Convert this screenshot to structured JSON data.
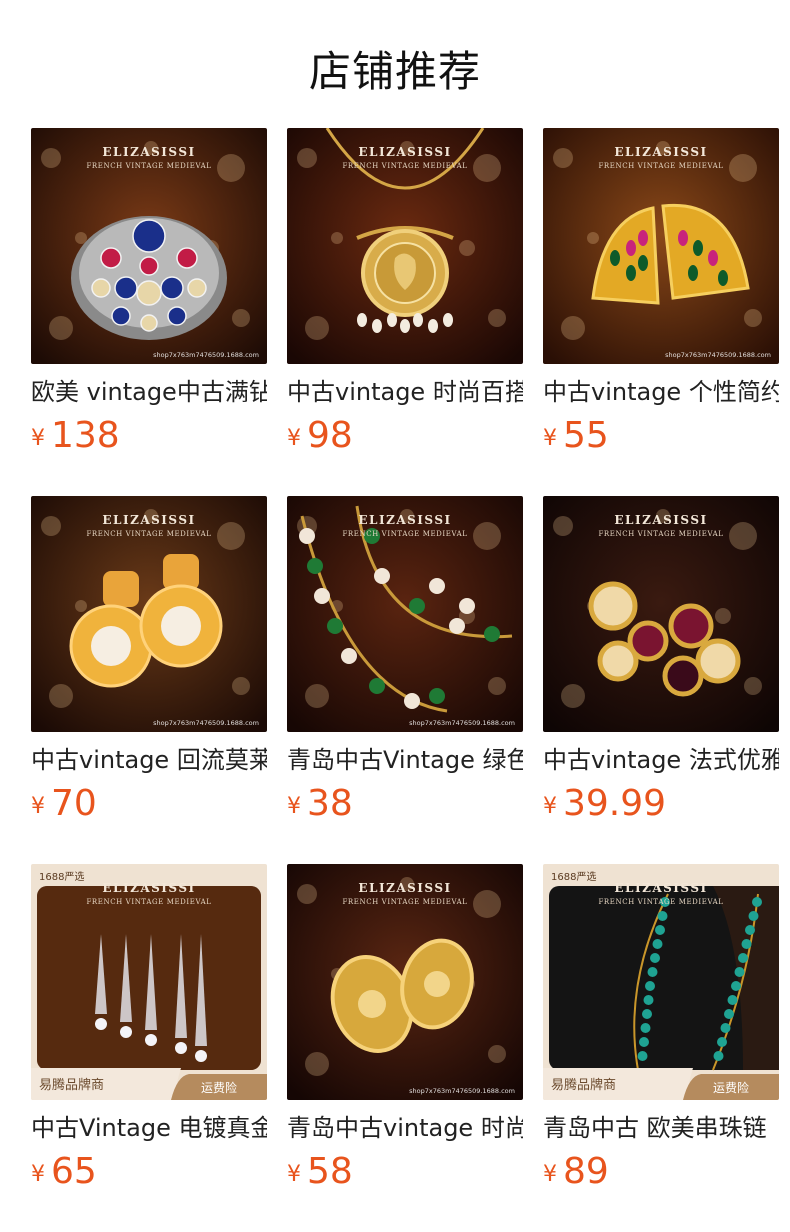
{
  "section": {
    "title": "店铺推荐"
  },
  "brand": {
    "name": "ELIZASISSI",
    "tagline": "FRENCH VINTAGE MEDIEVAL",
    "watermark": "shop7x763m7476509.1688.com"
  },
  "badges": {
    "yanxuan": "1688严选",
    "brand_store": "易腾品牌商",
    "shipping": "运费险"
  },
  "currency": "¥",
  "products": [
    {
      "name": "欧美 vintage中古满钻",
      "price": "138",
      "icon": "brooch-image",
      "theme": "sapphire-brooch"
    },
    {
      "name": "中古vintage 时尚百搭",
      "price": "98",
      "icon": "pendant-necklace-image",
      "theme": "gold-pendant"
    },
    {
      "name": "中古vintage 个性简约",
      "price": "55",
      "icon": "earring-image",
      "theme": "gold-earrings"
    },
    {
      "name": "中古vintage 回流莫莱",
      "price": "70",
      "icon": "pearl-earring-image",
      "theme": "pearl-earrings"
    },
    {
      "name": "青岛中古Vintage 绿色",
      "price": "38",
      "icon": "beaded-necklace-image",
      "theme": "green-necklace"
    },
    {
      "name": "中古vintage 法式优雅",
      "price": "39.99",
      "icon": "gem-earring-image",
      "theme": "gem-earrings"
    },
    {
      "name": "中古Vintage 电镀真金",
      "price": "65",
      "icon": "crystal-earring-image",
      "theme": "crystal-drops"
    },
    {
      "name": "青岛中古vintage 时尚",
      "price": "58",
      "icon": "gold-stud-image",
      "theme": "gold-studs"
    },
    {
      "name": "青岛中古 欧美串珠链",
      "price": "89",
      "icon": "turquoise-necklace-image",
      "theme": "turquoise-necklace"
    }
  ],
  "colors": {
    "price": "#e8541d",
    "title": "#111111",
    "name": "#222222"
  }
}
